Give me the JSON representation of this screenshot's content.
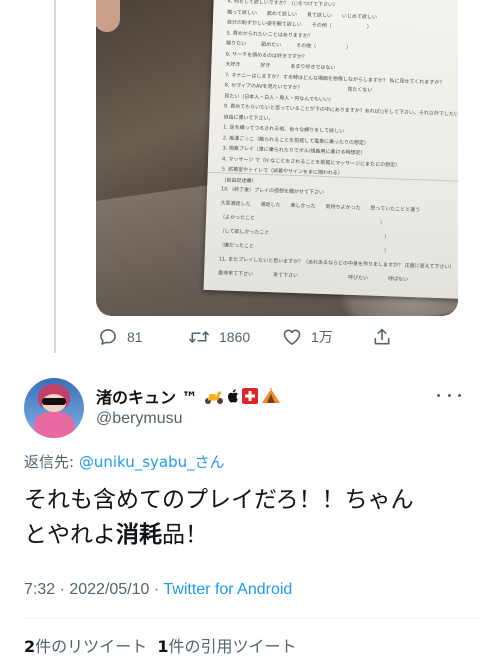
{
  "parent_tweet": {
    "image": {
      "sheet_lines": [
        "4. 何をして欲しいですか？（○をつけて下さい）",
        "触って欲しい　　舐めて欲しい　　見て欲しい　　いじめて欲しい",
        "自分の恥ずかしい姿を観て欲しい　　その他（　　　　　　　）",
        "5. 責めかられたいことはありますか？",
        "騎りたい　　　舐めたい　　　その他（　　　　　　）",
        "6. サーチを頭めるのは好きですか？",
        "大好き　　　　好き　　　　あまり好きではない",
        "7. オナニーはしますか？ する時はどんな場面を想像しながらしますか？ 私に見せてくれますか？",
        "8. セヴィアのAVを見たいですか？　　　　　　　　　見たくない",
        "見たい（日本人・白人・黒人・何なんでもいい）",
        "9. 責めてもらいたいと思っていることが下の中にありますか？あれば○をして下さい。それ以外でしたいことがあれば",
        "自由に書いて下さい。",
        "1. 足を縛ってつるされる他、色々な縛りをして欲しい",
        "2. 痴漢ごっこ（触られることを前提して電車に乗ったりの想定）",
        "3. 視姦プレイ（車に乗られたりでボル/視姦用に書ける時想定）",
        "4. マッサージ で（H なことをされることを前提にマッサージにまたどの想定）",
        "5. 試着室やトイレで（試着やサインをまに隠われる）",
        "（自由記述欄）",
        "10.（終了後）プレイの感想を聞かせて下さい",
        "大変満足した　　満足した　　楽しかった　　気持ちよかった　　思っていたことと違う",
        "（よかったこと　　　　　　　　　　　　　　　　　　　　　　　　　）",
        "（して欲しかったこと　　　　　　　　　　　　　　　　　　　　　　　）",
        "（嫌だったこと　　　　　　　　　　　　　　　　　　　　　　　　　　）",
        "11. またプレイしたいと思いますか？（あれあるならどの中身を作りましますか？ 正直に答えて下さい）",
        "是非来て下さい　　　　来て下さい　　　　　　　　　　呼びたい　　　　呼ばない"
      ]
    },
    "actions": {
      "reply_count": "81",
      "retweet_count": "1860",
      "like_count": "1万"
    }
  },
  "reply_tweet": {
    "display_name": "渚のキュン ™",
    "handle": "@berymusu",
    "reply_to_prefix": "返信先: ",
    "reply_to_user": "@uniku_syabu_さん",
    "text_line1": "それも含めてのプレイだろ！！ちゃん",
    "text_line2_start": "とやれよ",
    "text_bold": "消耗",
    "text_line2_end": "品！",
    "time": "7:32",
    "date": "2022/05/10",
    "source": "Twitter for Android",
    "retweets_num": "2",
    "retweets_label": "件のリツイート",
    "quotes_num": "1",
    "quotes_label": "件の引用ツイート"
  },
  "colors": {
    "link": "#1d9bf0",
    "secondary_text": "#536471",
    "primary_text": "#0f1419",
    "divider": "#eff3f4"
  },
  "icons": [
    "reply-icon",
    "retweet-icon",
    "like-icon",
    "share-icon",
    "more-icon",
    "scooter-emoji",
    "apple-logo-icon",
    "swiss-flag-emoji",
    "tent-emoji"
  ]
}
